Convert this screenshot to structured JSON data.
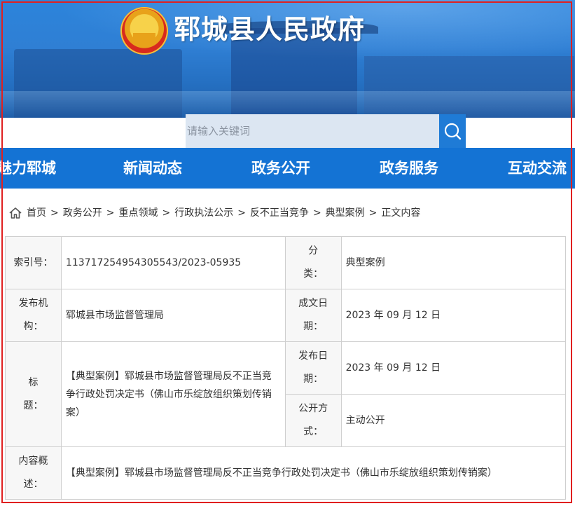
{
  "site": {
    "title": "郓城县人民政府"
  },
  "search": {
    "placeholder": "请输入关键词"
  },
  "nav": {
    "items": [
      {
        "label": "魅力郓城"
      },
      {
        "label": "新闻动态"
      },
      {
        "label": "政务公开"
      },
      {
        "label": "政务服务"
      },
      {
        "label": "互动交流"
      }
    ]
  },
  "breadcrumb": {
    "separator": ">",
    "items": [
      "首页",
      "政务公开",
      "重点领域",
      "行政执法公示",
      "反不正当竞争",
      "典型案例",
      "正文内容"
    ]
  },
  "meta": {
    "index_label_1": "索引号：",
    "index_value": "113717254954305543/2023-05935",
    "category_label_1": "分",
    "category_label_2": "类：",
    "category_value": "典型案例",
    "publisher_label_1": "发布机",
    "publisher_label_2": "构：",
    "publisher_value": "郓城县市场监督管理局",
    "created_label_1": "成文日",
    "created_label_2": "期：",
    "created_value": "2023 年 09 月 12 日",
    "title_label_1": "标",
    "title_label_2": "题：",
    "title_value": "【典型案例】郓城县市场监督管理局反不正当竞争行政处罚决定书（佛山市乐绽放组织策划传销案）",
    "pubdate_label_1": "发布日",
    "pubdate_label_2": "期：",
    "pubdate_value": "2023 年 09 月 12 日",
    "openness_label_1": "公开方",
    "openness_label_2": "式：",
    "openness_value": "主动公开",
    "summary_label_1": "内容概",
    "summary_label_2": "述：",
    "summary_value": "【典型案例】郓城县市场监督管理局反不正当竞争行政处罚决定书（佛山市乐绽放组织策划传销案）"
  },
  "colors": {
    "nav_bg": "#1473d4",
    "search_button": "#1f7bd6",
    "frame": "#e02020"
  },
  "icons": {
    "emblem": "national-emblem-icon",
    "search": "search-icon",
    "home": "home-icon"
  }
}
